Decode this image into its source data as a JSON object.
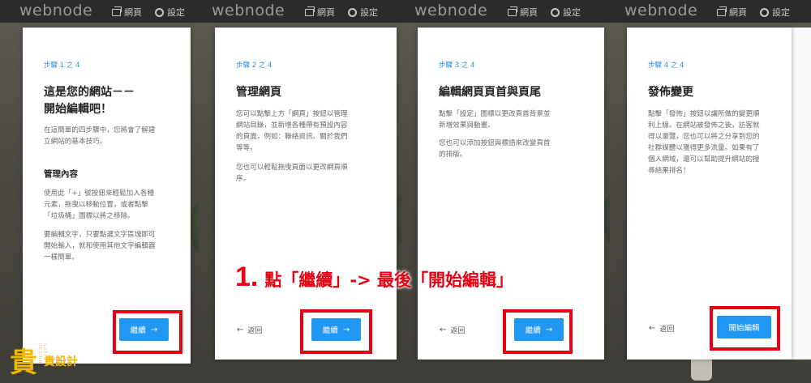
{
  "app": {
    "logo_text": "webnode",
    "nav_pages": "網頁",
    "nav_settings": "設定"
  },
  "steps": [
    {
      "step_label": "步驟 1 之 4",
      "title_lines": [
        "這是您的網站－－",
        "開始編輯吧！"
      ],
      "intro_lines": [
        "在這簡單的四步驟中，您將會了解建",
        "立網站的基本技巧。"
      ],
      "subhead": "管理內容",
      "body1_lines": [
        "使用此「+」號按鈕來輕鬆加入各種",
        "元素，拖曳以移動位置，或者點擊",
        "「垃圾桶」圖標以將之移除。"
      ],
      "body2_lines": [
        "要編輯文字，只要點選文字區塊即可",
        "開始輸入，就和使用其他文字編輯器",
        "一樣簡單。"
      ],
      "button": "繼續"
    },
    {
      "step_label": "步驟 2 之 4",
      "title_lines": [
        "管理網頁"
      ],
      "body1_lines": [
        "您可以點擊上方「網頁」按鈕以管理",
        "網站目錄，並新增各種帶有預設內容",
        "的頁面，例如：聯絡資訊、關於我們",
        "等等。"
      ],
      "body2_lines": [
        "您也可以輕鬆拖曳頁面以更改網頁順",
        "序。"
      ],
      "back": "返回",
      "button": "繼續"
    },
    {
      "step_label": "步驟 3 之 4",
      "title_lines": [
        "編輯網頁頁首與頁尾"
      ],
      "body1_lines": [
        "點擊「設定」圖標以更改頁首背景並",
        "新增效果與動畫。"
      ],
      "body2_lines": [
        "您也可以添加按鈕與標語來改變頁首",
        "的排版。"
      ],
      "back": "返回",
      "button": "繼續"
    },
    {
      "step_label": "步驟 4 之 4",
      "title_lines": [
        "發佈變更"
      ],
      "body1_lines": [
        "點擊「發佈」按鈕以讓所做的變更順",
        "利上線。在網站被發佈之後，訪客就",
        "得以瀏覽，您也可以將之分享到您的",
        "社群媒體以獲得更多流量。如果有了",
        "個人網域，還可以幫助提升網站的搜",
        "尋結果排名！"
      ],
      "back": "返回",
      "button": "開始編輯"
    }
  ],
  "annotation": {
    "number": "1.",
    "text": "點「繼續」-> 最後「開始編輯」",
    "color": "#e60012"
  },
  "watermark": {
    "glyph": "貴",
    "vertical_text": "GUEI DESIGN",
    "name": "貴設計",
    "color": "#f1b800"
  },
  "colors": {
    "accent": "#2196f3",
    "step_label": "#2b8cd8",
    "highlight": "#e60012"
  }
}
